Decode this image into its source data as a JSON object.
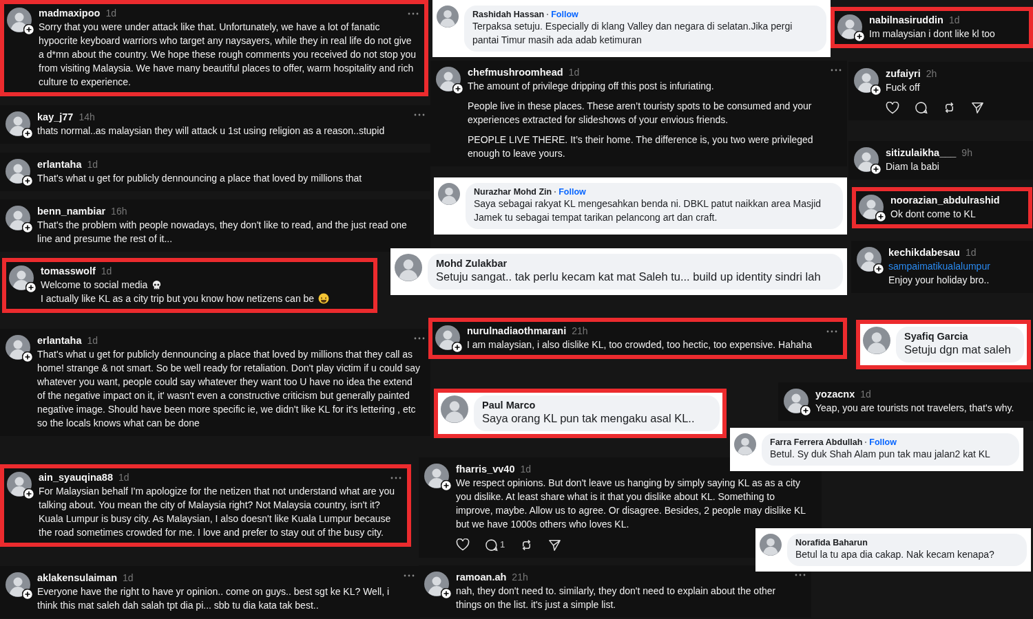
{
  "snippets": [
    {
      "kind": "threads",
      "highlighted": true,
      "user": "madmaxipoo",
      "time": "1d",
      "menu": true,
      "show_actions": false,
      "paragraphs": [
        "Sorry that you were under attack like that. Unfortunately, we have a lot of fanatic hypocrite keyboard warriors who target any naysayers, while they in real life do not give a d*mn about the country. We hope these rough comments you received do not stop you from visiting Malaysia. We have many beautiful places to offer, warm hospitality and rich culture to experience."
      ]
    },
    {
      "kind": "facebook",
      "highlighted": false,
      "name": "Rashidah Hassan",
      "follow": "Follow",
      "text": "Terpaksa setuju. Especially di klang Valley dan negara di selatan.Jika pergi pantai Timur masih ada adab ketimuran"
    },
    {
      "kind": "threads",
      "highlighted": true,
      "user": "nabilnasiruddin",
      "time": "1d",
      "menu": false,
      "show_actions": false,
      "paragraphs": [
        "Im malaysian i dont like kl too"
      ]
    },
    {
      "kind": "threads",
      "highlighted": false,
      "user": "chefmushroomhead",
      "time": "1d",
      "menu": true,
      "show_actions": false,
      "paragraphs": [
        "The amount of privilege dripping off this post is infuriating.",
        "People live in these places. These aren’t touristy spots to be consumed and your experiences extracted for slideshows of your envious friends.",
        "PEOPLE LIVE THERE. It’s their home. The difference is, you two were privileged enough to leave yours."
      ]
    },
    {
      "kind": "threads",
      "highlighted": false,
      "user": "zufaiyri",
      "time": "2h",
      "menu": false,
      "show_actions": true,
      "paragraphs": [
        "Fuck off"
      ]
    },
    {
      "kind": "threads",
      "highlighted": false,
      "user": "kay_j77",
      "time": "14h",
      "menu": true,
      "show_actions": false,
      "paragraphs": [
        "thats normal..as malaysian they will attack u 1st using religion as a reason..stupid"
      ]
    },
    {
      "kind": "threads",
      "highlighted": false,
      "user": "erlantaha",
      "time": "1d",
      "menu": false,
      "show_actions": false,
      "paragraphs": [
        "That's what u get for publicly dennouncing a place that loved by millions that"
      ]
    },
    {
      "kind": "threads",
      "highlighted": false,
      "user": "sitizulaikha___",
      "time": "9h",
      "menu": false,
      "show_actions": false,
      "paragraphs": [
        "Diam la babi"
      ]
    },
    {
      "kind": "threads",
      "highlighted": false,
      "user": "benn_nambiar",
      "time": "16h",
      "menu": false,
      "show_actions": false,
      "paragraphs": [
        "That's the problem with people nowadays, they don't like to read, and the just read one line and presume the rest of it..."
      ]
    },
    {
      "kind": "facebook",
      "highlighted": false,
      "name": "Nurazhar Mohd Zin",
      "follow": "Follow",
      "text": "Saya sebagai rakyat KL mengesahkan benda ni. DBKL patut naikkan area Masjid Jamek tu sebagai tempat tarikan pelancong art dan craft."
    },
    {
      "kind": "threads",
      "highlighted": true,
      "user": "noorazian_abdulrashid",
      "menu": false,
      "show_actions": false,
      "paragraphs": [
        "Ok dont come to KL"
      ]
    },
    {
      "kind": "threads",
      "highlighted": true,
      "user": "tomasswolf",
      "time": "1d",
      "menu": false,
      "show_actions": false,
      "lines": [
        "Welcome to social media",
        "I actually like KL as a city trip but you know how netizens can be"
      ]
    },
    {
      "kind": "facebook",
      "highlighted": false,
      "name": "Mohd Zulakbar",
      "text": "Setuju sangat.. tak perlu kecam kat mat Saleh tu... build up identity sindri lah"
    },
    {
      "kind": "threads",
      "highlighted": false,
      "user": "kechikdabesau",
      "time": "1d",
      "menu": false,
      "show_actions": false,
      "mention": "sampaimatikualalumpur",
      "paragraphs": [
        "Enjoy your holiday bro.."
      ]
    },
    {
      "kind": "threads",
      "highlighted": false,
      "user": "erlantaha",
      "time": "1d",
      "menu": true,
      "show_actions": false,
      "paragraphs": [
        "That's what u get for publicly dennouncing a place that loved by millions that they call as home! strange & not smart. So be well ready for retaliation. Don't play victim if u could say whatever you want, people could say whatever they want too U have no idea the extend of the negative impact on it, it' wasn't even a constructive criticism but generally painted negative image. Should have been more specific ie, we didn't like KL for it's lettering , etc so the locals knows what can be done"
      ]
    },
    {
      "kind": "threads",
      "highlighted": true,
      "user": "nurulnadiaothmarani",
      "time": "21h",
      "menu": true,
      "show_actions": false,
      "paragraphs": [
        "I am malaysian, i also dislike KL, too crowded, too hectic, too expensive. Hahaha"
      ]
    },
    {
      "kind": "facebook",
      "highlighted": true,
      "name": "Syafiq Garcia",
      "text": "Setuju dgn mat saleh"
    },
    {
      "kind": "facebook",
      "highlighted": true,
      "name": "Paul Marco",
      "text": "Saya orang KL pun tak mengaku asal KL.."
    },
    {
      "kind": "threads",
      "highlighted": false,
      "user": "yozacnx",
      "time": "1d",
      "menu": false,
      "show_actions": false,
      "paragraphs": [
        "Yeap, you are tourists not travelers, that's why."
      ]
    },
    {
      "kind": "facebook",
      "highlighted": false,
      "name": "Farra Ferrera Abdullah",
      "follow": "Follow",
      "text": "Betul. Sy duk Shah Alam pun tak mau jalan2 kat KL"
    },
    {
      "kind": "threads",
      "highlighted": true,
      "user": "ain_syauqina88",
      "time": "1d",
      "menu": true,
      "show_actions": false,
      "paragraphs": [
        "For Malaysian behalf I'm apologize for the netizen that not understand what are you talking about. You mean the city of Malaysia right? Not Malaysia country, isn't it? Kuala Lumpur is busy city. As Malaysian, I also doesn't like Kuala Lumpur because the road sometimes crowded for me. I love and prefer to stay out of the busy city."
      ]
    },
    {
      "kind": "threads",
      "highlighted": false,
      "user": "fharris_vv40",
      "time": "1d",
      "menu": false,
      "show_actions": true,
      "reply_count": "1",
      "paragraphs": [
        "We respect opinions. But don't leave us hanging by simply saying KL as as a city you dislike. At least share what is it that you dislike about KL. Something to improve, maybe. Allow us to agree. Or disagree. Besides, 2 people may dislike KL but we have 1000s others who loves KL."
      ]
    },
    {
      "kind": "facebook",
      "highlighted": false,
      "name": "Norafida Baharun",
      "text": "Betul la tu apa dia cakap. Nak kecam kenapa?"
    },
    {
      "kind": "threads",
      "highlighted": false,
      "user": "aklakensulaiman",
      "time": "1d",
      "menu": true,
      "show_actions": false,
      "paragraphs": [
        "Everyone have the right to have yr opinion.. come on guys.. best sgt ke KL? Well, i think this mat saleh dah salah tpt dia pi... sbb tu dia kata tak best.."
      ]
    },
    {
      "kind": "threads",
      "highlighted": false,
      "user": "ramoan.ah",
      "time": "21h",
      "menu": true,
      "show_actions": false,
      "paragraphs": [
        "nah, they don't need to. similarly, they don't need to explain about the other things on the list. it's just a simple list."
      ]
    }
  ]
}
